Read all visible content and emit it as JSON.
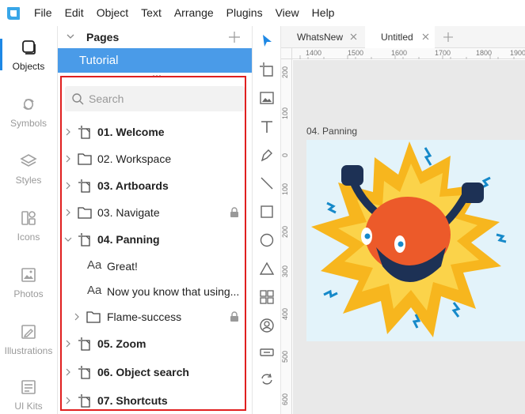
{
  "menu": {
    "items": [
      "File",
      "Edit",
      "Object",
      "Text",
      "Arrange",
      "Plugins",
      "View",
      "Help"
    ]
  },
  "rail": {
    "items": [
      {
        "label": "Objects",
        "icon": "objects-icon",
        "active": true
      },
      {
        "label": "Symbols",
        "icon": "symbols-icon",
        "active": false
      },
      {
        "label": "Styles",
        "icon": "styles-icon",
        "active": false
      },
      {
        "label": "Icons",
        "icon": "icons-icon",
        "active": false
      },
      {
        "label": "Photos",
        "icon": "photos-icon",
        "active": false
      },
      {
        "label": "Illustrations",
        "icon": "illustrations-icon",
        "active": false
      },
      {
        "label": "UI Kits",
        "icon": "ui-kits-icon",
        "active": false
      }
    ]
  },
  "panel": {
    "pages_title": "Pages",
    "current_page": "Tutorial",
    "search_placeholder": "Search",
    "layers": [
      {
        "label": "01. Welcome",
        "icon": "artboard-icon",
        "bold": true,
        "expander": "right",
        "indent": 0,
        "locked": false
      },
      {
        "label": "02. Workspace",
        "icon": "folder-icon",
        "bold": false,
        "expander": "right",
        "indent": 0,
        "locked": false
      },
      {
        "label": "03. Artboards",
        "icon": "artboard-icon",
        "bold": true,
        "expander": "right",
        "indent": 0,
        "locked": false
      },
      {
        "label": "03. Navigate",
        "icon": "folder-icon",
        "bold": false,
        "expander": "right",
        "indent": 0,
        "locked": true
      },
      {
        "label": "04. Panning",
        "icon": "artboard-icon",
        "bold": true,
        "expander": "down",
        "indent": 0,
        "locked": false
      },
      {
        "label": "Great!",
        "icon": "text-icon",
        "bold": false,
        "expander": "none",
        "indent": 1,
        "locked": false
      },
      {
        "label": "Now you know that using...",
        "icon": "text-icon",
        "bold": false,
        "expander": "none",
        "indent": 1,
        "locked": false
      },
      {
        "label": "Flame-success",
        "icon": "folder-icon",
        "bold": false,
        "expander": "right",
        "indent": 1,
        "locked": true
      },
      {
        "label": "05. Zoom",
        "icon": "artboard-icon",
        "bold": true,
        "expander": "right",
        "indent": 0,
        "locked": false
      },
      {
        "label": "06. Object search",
        "icon": "artboard-icon",
        "bold": true,
        "expander": "right",
        "indent": 0,
        "locked": false
      },
      {
        "label": "07. Shortcuts",
        "icon": "artboard-icon",
        "bold": true,
        "expander": "right",
        "indent": 0,
        "locked": false
      }
    ]
  },
  "tools": [
    "pointer-tool-icon",
    "artboard-tool-icon",
    "image-tool-icon",
    "text-tool-icon",
    "pen-tool-icon",
    "line-tool-icon",
    "rectangle-tool-icon",
    "ellipse-tool-icon",
    "triangle-tool-icon",
    "grid-tool-icon",
    "avatar-tool-icon",
    "button-tool-icon",
    "rotate-tool-icon"
  ],
  "tabs": [
    {
      "label": "WhatsNew",
      "active": false
    },
    {
      "label": "Untitled",
      "active": true
    }
  ],
  "ruler": {
    "top": [
      "1400",
      "1500",
      "1600",
      "1700",
      "1800",
      "1900"
    ],
    "left": [
      "200",
      "100",
      "0",
      "100",
      "200",
      "300",
      "400",
      "500",
      "600"
    ]
  },
  "canvas": {
    "artboard_label": "04. Panning"
  },
  "colors": {
    "accent": "#4a9be8",
    "highlight": "#e02020",
    "artboard_bg": "#e3f3fa"
  }
}
